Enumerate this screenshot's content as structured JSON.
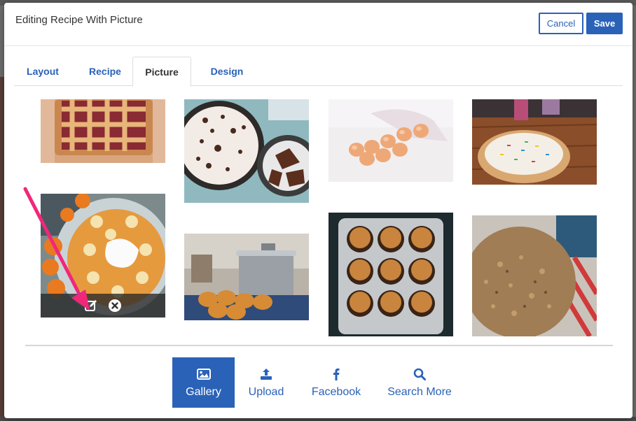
{
  "modal": {
    "title": "Editing Recipe With Picture",
    "cancel_label": "Cancel",
    "save_label": "Save"
  },
  "tabs": [
    {
      "label": "Layout",
      "active": false
    },
    {
      "label": "Recipe",
      "active": false
    },
    {
      "label": "Picture",
      "active": true
    },
    {
      "label": "Design",
      "active": false
    }
  ],
  "gallery": {
    "images": [
      {
        "subject": "lattice cherry pie"
      },
      {
        "subject": "chocolate cream pie"
      },
      {
        "subject": "eggs on white"
      },
      {
        "subject": "sprinkle cake on table"
      },
      {
        "subject": "peach and banana tart",
        "selected": true
      },
      {
        "subject": "pot and bread rolls"
      },
      {
        "subject": "muffins in tin"
      },
      {
        "subject": "crumble pie with striped towel"
      }
    ],
    "selected_toolbar": {
      "edit_icon": "edit-icon",
      "remove_icon": "close-circle-icon"
    }
  },
  "sources": [
    {
      "label": "Gallery",
      "icon": "image-icon",
      "active": true
    },
    {
      "label": "Upload",
      "icon": "upload-icon",
      "active": false
    },
    {
      "label": "Facebook",
      "icon": "facebook-icon",
      "active": false
    },
    {
      "label": "Search More",
      "icon": "search-icon",
      "active": false
    }
  ],
  "colors": {
    "accent": "#2a62b8",
    "annotation_arrow": "#f0287a"
  }
}
